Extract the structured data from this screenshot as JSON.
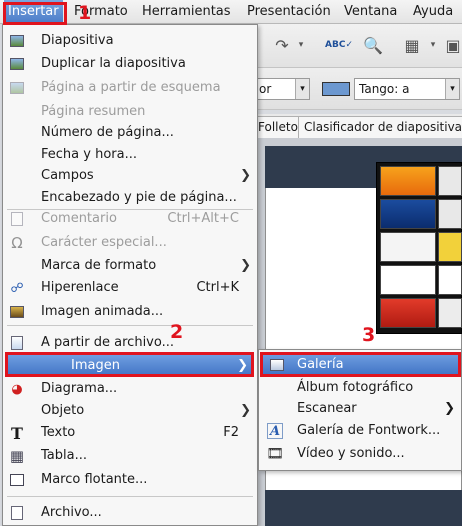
{
  "menubar": {
    "items": [
      "Insertar",
      "Formato",
      "Herramientas",
      "Presentación",
      "Ventana",
      "Ayuda"
    ]
  },
  "background": {
    "toolbar": {
      "dropdown1": "or",
      "dropdown2": "Tango: a",
      "swatch_color": "#6c98d0"
    },
    "tabs": [
      "Folleto",
      "Clasificador de diapositivas"
    ]
  },
  "insert_menu": {
    "items": [
      {
        "label": "Diapositiva",
        "icon": "new-slide-icon",
        "enabled": true
      },
      {
        "label": "Duplicar la diapositiva",
        "icon": "duplicate-slide-icon",
        "enabled": true
      },
      {
        "label": "Página a partir de esquema",
        "icon": "outline-page-icon",
        "enabled": false
      },
      {
        "label": "Página resumen",
        "icon": "",
        "enabled": false
      },
      {
        "label": "Número de página...",
        "icon": "",
        "enabled": true
      },
      {
        "label": "Fecha y hora...",
        "icon": "",
        "enabled": true
      },
      {
        "label": "Campos",
        "icon": "",
        "enabled": true,
        "submenu": true
      },
      {
        "label": "Encabezado y pie de página...",
        "icon": "",
        "enabled": true
      },
      {
        "label": "Comentario",
        "icon": "comment-icon",
        "enabled": false,
        "shortcut": "Ctrl+Alt+C"
      },
      {
        "label": "Carácter especial...",
        "icon": "omega-icon",
        "enabled": false
      },
      {
        "label": "Marca de formato",
        "icon": "",
        "enabled": true,
        "submenu": true
      },
      {
        "label": "Hiperenlace",
        "icon": "hyperlink-icon",
        "enabled": true,
        "shortcut": "Ctrl+K"
      },
      {
        "label": "Imagen animada...",
        "icon": "animated-image-icon",
        "enabled": true
      },
      {
        "label": "A partir de archivo...",
        "icon": "from-file-icon",
        "enabled": true
      },
      {
        "label": "Imagen",
        "icon": "",
        "enabled": true,
        "submenu": true,
        "highlighted": true
      },
      {
        "label": "Diagrama...",
        "icon": "chart-icon",
        "enabled": true
      },
      {
        "label": "Objeto",
        "icon": "",
        "enabled": true,
        "submenu": true
      },
      {
        "label": "Texto",
        "icon": "text-icon",
        "enabled": true,
        "shortcut": "F2"
      },
      {
        "label": "Tabla...",
        "icon": "table-icon",
        "enabled": true
      },
      {
        "label": "Marco flotante...",
        "icon": "floating-frame-icon",
        "enabled": true
      },
      {
        "label": "Archivo...",
        "icon": "file-icon",
        "enabled": true
      }
    ]
  },
  "image_submenu": {
    "items": [
      {
        "label": "Galería",
        "icon": "gallery-icon",
        "highlighted": true
      },
      {
        "label": "Álbum fotográfico",
        "icon": ""
      },
      {
        "label": "Escanear",
        "icon": "",
        "submenu": true
      },
      {
        "label": "Galería de Fontwork...",
        "icon": "fontwork-icon"
      },
      {
        "label": "Vídeo y sonido...",
        "icon": "video-icon"
      }
    ]
  },
  "annotations": [
    "1",
    "2",
    "3"
  ],
  "colors": {
    "highlight": "#4a7bc8",
    "annotation_red": "#e0141e"
  }
}
